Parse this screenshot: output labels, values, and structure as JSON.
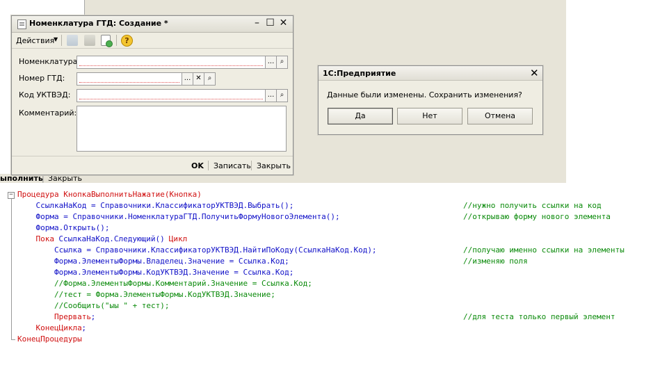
{
  "background": {
    "run_label": "ыполнить",
    "separator": "|",
    "close_label": "Закрыть"
  },
  "form": {
    "title": "Номенклатура ГТД: Создание *",
    "window_controls": {
      "minimize": "–",
      "maximize": "☐",
      "close": "✕"
    },
    "toolbar": {
      "actions_label": "Действия",
      "icons": [
        "post-icon",
        "structure-icon",
        "copy-new-icon"
      ],
      "help_label": "?"
    },
    "fields": [
      {
        "label": "Номенклатура:",
        "value": ""
      },
      {
        "label": "Номер ГТД:",
        "value": ""
      },
      {
        "label": "Код УКТВЭД:",
        "value": ""
      },
      {
        "label": "Комментарий:",
        "value": ""
      }
    ],
    "select_glyph": "...",
    "clear_glyph": "✕",
    "search_glyph": "⌕",
    "buttons": {
      "ok": "OK",
      "write": "Записать",
      "close": "Закрыть"
    }
  },
  "dialog": {
    "title": "1С:Предприятие",
    "close_glyph": "✕",
    "message": "Данные были изменены. Сохранить изменения?",
    "buttons": {
      "yes": "Да",
      "no": "Нет",
      "cancel": "Отмена"
    }
  },
  "code": {
    "fold_glyph": "−",
    "lines": [
      {
        "kind": "kw",
        "text": "Процедура КнопкаВыполнитьНажатие(Кнопка)",
        "comment": ""
      },
      {
        "kind": "code",
        "text": "    СсылкаНаКод = Справочники.КлассификаторУКТВЭД.Выбрать();",
        "comment": "//нужно получить ссылки на код"
      },
      {
        "kind": "code",
        "text": "    Форма = Справочники.НоменклатураГТД.ПолучитьФормуНовогоЭлемента();",
        "comment": "//открываю форму нового элемента"
      },
      {
        "kind": "code",
        "text": "    Форма.Открыть();",
        "comment": ""
      },
      {
        "kind": "kwmix",
        "kw": "    Пока ",
        "text": "СсылкаНаКод.Следующий() ",
        "kw2": "Цикл",
        "comment": ""
      },
      {
        "kind": "code",
        "text": "        Ссылка = Справочники.КлассификаторУКТВЭД.НайтиПоКоду(СсылкаНаКод.Код);",
        "comment": "//получаю именно ссылки на элементы"
      },
      {
        "kind": "code",
        "text": "        Форма.ЭлементыФормы.Владелец.Значение = Ссылка.Код;",
        "comment": "//изменяю поля"
      },
      {
        "kind": "code",
        "text": "        Форма.ЭлементыФормы.КодУКТВЭД.Значение = Ссылка.Код;",
        "comment": ""
      },
      {
        "kind": "cm",
        "text": "        //Форма.ЭлементыФормы.Комментарий.Значение = Ссылка.Код;",
        "comment": ""
      },
      {
        "kind": "cm",
        "text": "        //тест = Форма.ЭлементыФормы.КодУКТВЭД.Значение;",
        "comment": ""
      },
      {
        "kind": "cm",
        "text": "        //Сообщить(\"ыы \" + тест);",
        "comment": ""
      },
      {
        "kind": "kwsemi",
        "text": "        Прервать",
        "tail": ";",
        "comment": "//для теста только первый элемент"
      },
      {
        "kind": "kwsemi",
        "text": "    КонецЦикла",
        "tail": ";",
        "comment": ""
      },
      {
        "kind": "kw",
        "text": "КонецПроцедуры",
        "comment": ""
      }
    ]
  }
}
